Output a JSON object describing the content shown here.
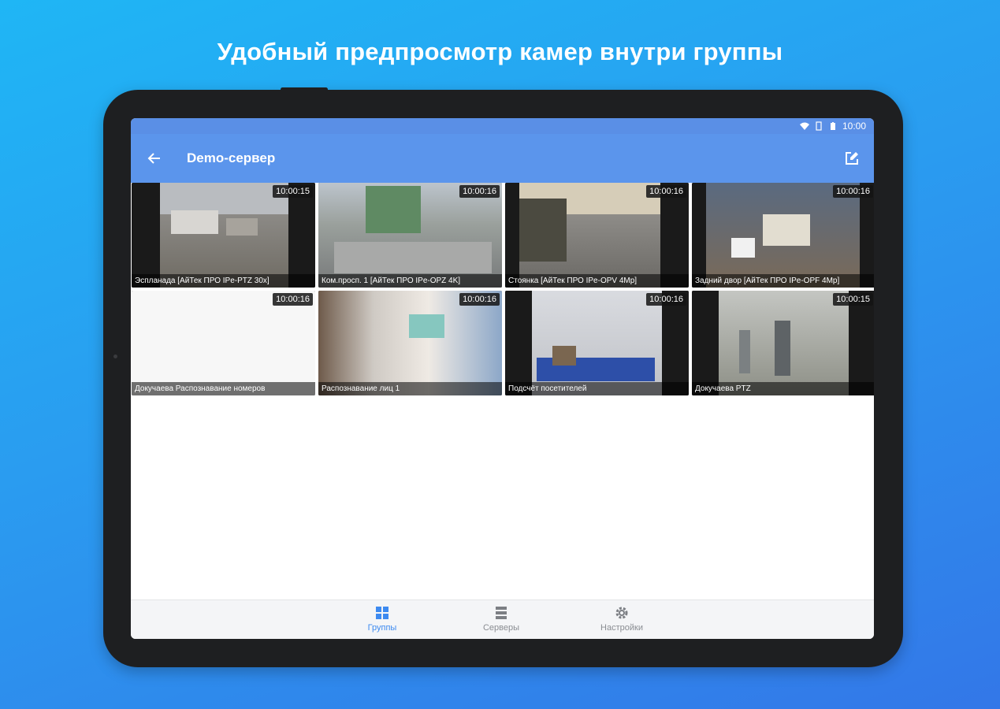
{
  "headline": "Удобный предпросмотр камер внутри группы",
  "status_bar": {
    "time": "10:00"
  },
  "app_bar": {
    "title": "Demo-сервер"
  },
  "cameras": [
    {
      "time": "10:00:15",
      "caption": "Эспланада [АйТек ПРО IPe-PTZ 30x]",
      "scene": "city-aerial"
    },
    {
      "time": "10:00:16",
      "caption": "Ком.просп. 1 [АйТек ПРО IPe-OPZ 4K]",
      "scene": "street"
    },
    {
      "time": "10:00:16",
      "caption": "Стоянка [АйТек ПРО IPe-OPV 4Mp]",
      "scene": "parking"
    },
    {
      "time": "10:00:16",
      "caption": "Задний двор [АйТек ПРО IPe-OPF 4Mp]",
      "scene": "backyard"
    },
    {
      "time": "10:00:16",
      "caption": "Докучаева Распознавание номеров",
      "scene": "white"
    },
    {
      "time": "10:00:16",
      "caption": "Распознавание лиц 1",
      "scene": "corridor"
    },
    {
      "time": "10:00:16",
      "caption": "Подсчёт посетителей",
      "scene": "office"
    },
    {
      "time": "10:00:15",
      "caption": "Докучаева PTZ",
      "scene": "skyline"
    }
  ],
  "bottom_nav": [
    {
      "label": "Группы",
      "icon": "grid-icon",
      "active": true
    },
    {
      "label": "Серверы",
      "icon": "list-icon",
      "active": false
    },
    {
      "label": "Настройки",
      "icon": "gear-icon",
      "active": false
    }
  ],
  "colors": {
    "accent": "#3d8af0",
    "appbar": "#5b95ec",
    "statusbar": "#5a8fe6"
  }
}
